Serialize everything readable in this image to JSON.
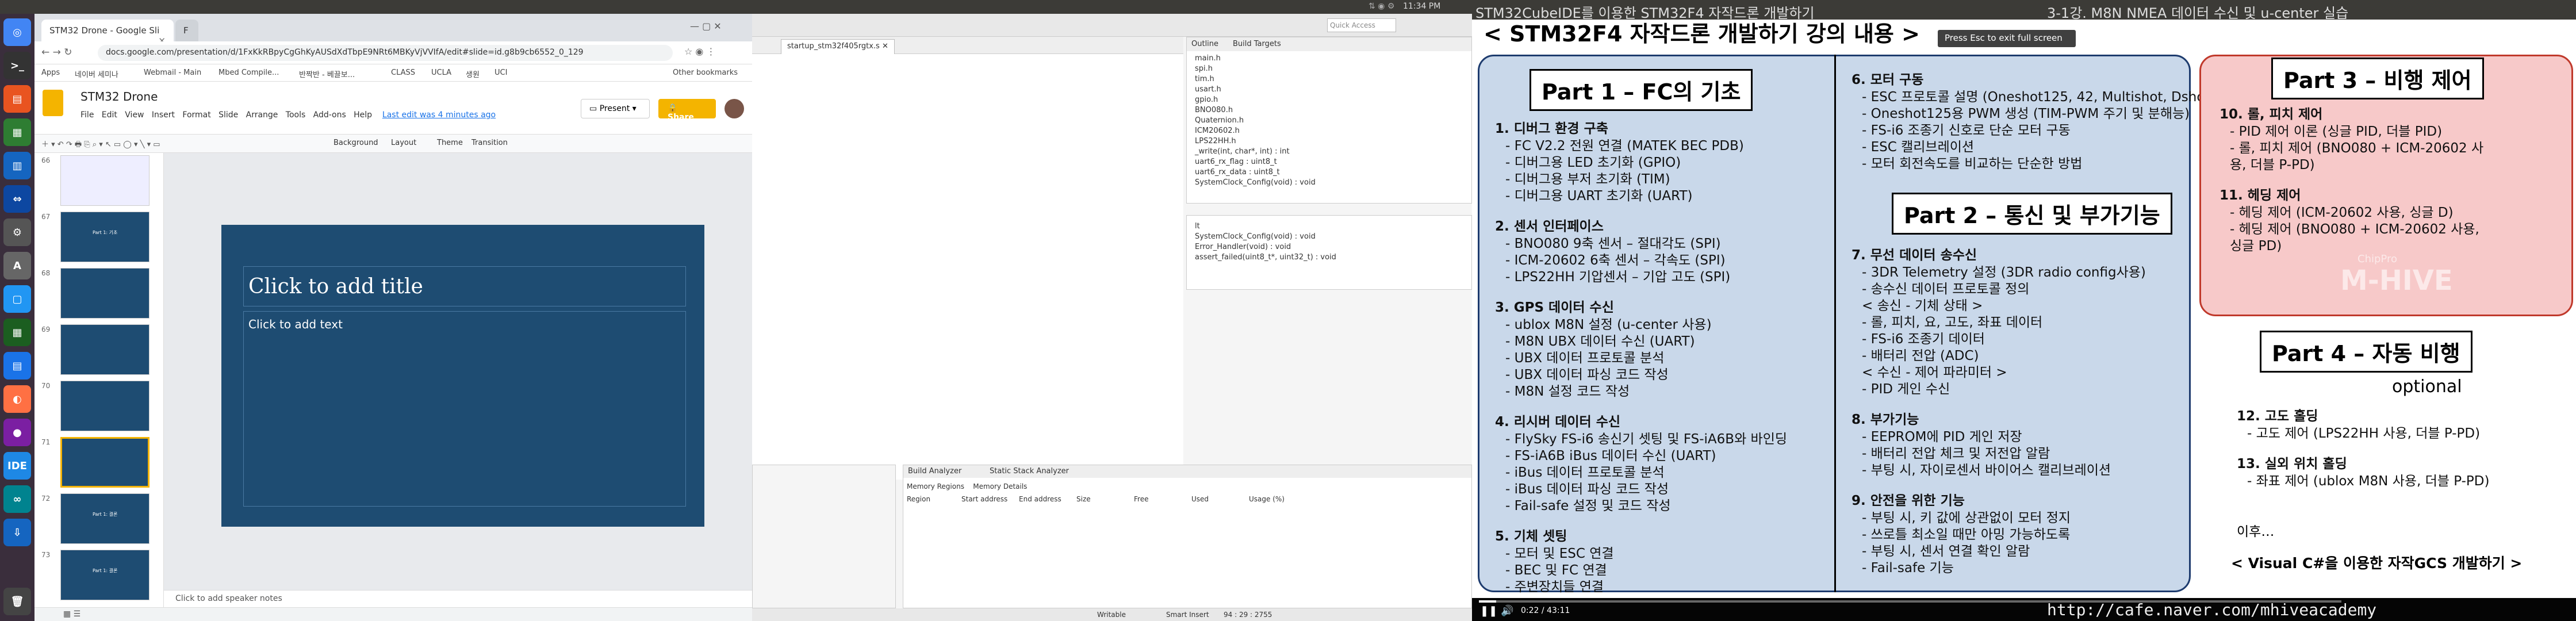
{
  "topbar": {
    "time": "11:34 PM"
  },
  "chrome": {
    "tabs": [
      "STM32 Drone - Google Sli",
      "F"
    ],
    "url": "docs.google.com/presentation/d/1FxKkRBpyCgGhKyAUSdXdTbpE9NRt6MBKyVjVVIfA/edit#slide=id.g8b9cb6552_0_129",
    "bookmarks": [
      "Apps",
      "네이버 세미나",
      "Webmail - Main",
      "Mbed Compile...",
      "반짝반 - 베끌보...",
      "CLASS",
      "UCLA",
      "생원",
      "UCI",
      "Other bookmarks"
    ]
  },
  "slides": {
    "title": "STM32 Drone",
    "menu": [
      "File",
      "Edit",
      "View",
      "Insert",
      "Format",
      "Slide",
      "Arrange",
      "Tools",
      "Add-ons",
      "Help"
    ],
    "last_edit": "Last edit was 4 minutes ago",
    "present": "Present",
    "share": "Share",
    "toolbar": [
      "Background",
      "Layout",
      "Theme",
      "Transition"
    ],
    "thumb_numbers": [
      "66",
      "67",
      "68",
      "69",
      "70",
      "71",
      "72",
      "73"
    ],
    "thumb_labels": [
      "",
      "Part 1: 기초",
      "",
      "",
      "",
      "",
      "Part 1: 결론",
      "Part 1: 결론"
    ],
    "placeholder_title": "Click to add title",
    "placeholder_text": "Click to add text",
    "speaker_notes": "Click to add speaker notes"
  },
  "eclipse": {
    "editor_tab": "startup_stm32f405rgtx.s",
    "outline_tabs": [
      "Outline",
      "Build Targets"
    ],
    "outline_items": [
      "main.h",
      "spi.h",
      "tim.h",
      "usart.h",
      "gpio.h",
      "BNO080.h",
      "Quaternion.h",
      "ICM20602.h",
      "LPS22HH.h",
      "_write(int, char*, int) : int",
      "uart6_rx_flag : uint8_t",
      "uart6_rx_data : uint8_t",
      "SystemClock_Config(void) : void"
    ],
    "outline_items2": [
      "lt",
      "SystemClock_Config(void) : void",
      "Error_Handler(void) : void",
      "assert_failed(uint8_t*, uint32_t) : void"
    ],
    "bottom_tabs": [
      "Build Analyzer",
      "Static Stack Analyzer"
    ],
    "memory_tabs": [
      "Memory Regions",
      "Memory Details"
    ],
    "memory_cols": [
      "Region",
      "Start address",
      "End address",
      "Size",
      "Free",
      "Used",
      "Usage (%)"
    ],
    "status": [
      "Writable",
      "Smart Insert",
      "94 : 29 : 2755"
    ]
  },
  "video": {
    "header_left": "STM32CubeIDE를 이용한 STM32F4 자작드론 개발하기",
    "header_right": "3-1강. M8N NMEA 데이터 수신 및 u-center 실습",
    "fullscreen_hint": "Press Esc to exit full screen",
    "slide_title": "< STM32F4 자작드론 개발하기 강의 내용 >",
    "part1": {
      "title": "Part 1 – FC의 기초",
      "sections": [
        {
          "head": "1. 디버그 환경 구축",
          "items": [
            "- FC V2.2 전원 연결 (MATEK BEC PDB)",
            "- 디버그용 LED 초기화 (GPIO)",
            "- 디버그용 부저 초기화 (TIM)",
            "- 디버그용 UART 초기화 (UART)"
          ]
        },
        {
          "head": "2. 센서 인터페이스",
          "items": [
            "- BNO080 9축 센서 – 절대각도 (SPI)",
            "- ICM-20602 6축 센서 – 각속도 (SPI)",
            "- LPS22HH 기압센서 – 기압 고도 (SPI)"
          ]
        },
        {
          "head": "3. GPS 데이터 수신",
          "items": [
            "- ublox M8N 설정 (u-center 사용)",
            "- M8N UBX 데이터 수신 (UART)",
            "- UBX 데이터 프로토콜 분석",
            "- UBX 데이터 파싱 코드 작성",
            "- M8N 설정 코드 작성"
          ]
        },
        {
          "head": "4. 리시버 데이터 수신",
          "items": [
            "- FlySky FS-i6 송신기 셋팅 및 FS-iA6B와 바인딩",
            "- FS-iA6B iBus 데이터 수신 (UART)",
            "- iBus 데이터 프로토콜 분석",
            "- iBus 데이터 파싱 코드 작성",
            "- Fail-safe 설정 및 코드 작성"
          ]
        },
        {
          "head": "5. 기체 셋팅",
          "items": [
            "- 모터 및 ESC 연결",
            "- BEC 및 FC 연결",
            "- 주변장치들 연결"
          ]
        }
      ]
    },
    "part1b": {
      "sections": [
        {
          "head": "6. 모터 구동",
          "items": [
            "- ESC 프로토콜 설명 (Oneshot125, 42, Multishot, Dshot)",
            "- Oneshot125용 PWM 생성 (TIM-PWM 주기 및 분해능)",
            "- FS-i6 조종기 신호로 단순 모터 구동",
            "- ESC 캘리브레이션",
            "- 모터 회전속도를 비교하는 단순한 방법"
          ]
        }
      ]
    },
    "part2": {
      "title": "Part 2 – 통신 및 부가기능",
      "sections": [
        {
          "head": "7. 무선 데이터 송수신",
          "items": [
            "- 3DR Telemetry 설정 (3DR radio config사용)",
            "- 송수신 데이터 프로토콜 정의",
            "< 송신 - 기체 상태 >",
            "- 롤, 피치, 요, 고도, 좌표 데이터",
            "- FS-i6 조종기 데이터",
            "- 배터리 전압 (ADC)",
            "< 수신 - 제어 파라미터 >",
            "- PID 게인 수신"
          ]
        },
        {
          "head": "8. 부가기능",
          "items": [
            "- EEPROM에 PID 게인 저장",
            "- 배터리 전압 체크 및 저전압 알람",
            "- 부팅 시, 자이로센서 바이어스 캘리브레이션"
          ]
        },
        {
          "head": "9. 안전을 위한 기능",
          "items": [
            "- 부팅 시, 키 값에 상관없이 모터 정지",
            "- 쓰로틀 최소일 때만 아밍 가능하도록",
            "- 부팅 시, 센서 연결 확인 알람",
            "- Fail-safe 기능"
          ]
        }
      ]
    },
    "part3": {
      "title": "Part 3 – 비행 제어",
      "sections": [
        {
          "head": "10. 롤, 피치 제어",
          "items": [
            "- PID 제어 이론 (싱글 PID, 더블 PID)",
            "- 롤, 피치 제어 (BNO080 + ICM-20602 사",
            "용, 더블 P-PD)"
          ]
        },
        {
          "head": "11. 헤딩 제어",
          "items": [
            "- 헤딩 제어 (ICM-20602 사용, 싱글 D)",
            "- 헤딩 제어 (BNO080 + ICM-20602 사용,",
            "싱글 PD)"
          ]
        }
      ]
    },
    "watermark": "M-HIVE",
    "watermark_small": "ChipPro",
    "part4": {
      "title": "Part 4 – 자동 비행",
      "optional": "optional",
      "sections": [
        {
          "head": "12. 고도 홀딩",
          "items": [
            "- 고도 제어  (LPS22HH 사용, 더블 P-PD)"
          ]
        },
        {
          "head": "13. 실외 위치 홀딩",
          "items": [
            "- 좌표 제어 (ublox M8N 사용, 더블 P-PD)"
          ]
        }
      ]
    },
    "after": "이후…",
    "gcs": "< Visual C#을 이용한 자작GCS 개발하기 >",
    "url_watermark": "http://cafe.naver.com/mhiveacademy",
    "time": "0:22 / 43:11",
    "progress": 0.02
  }
}
